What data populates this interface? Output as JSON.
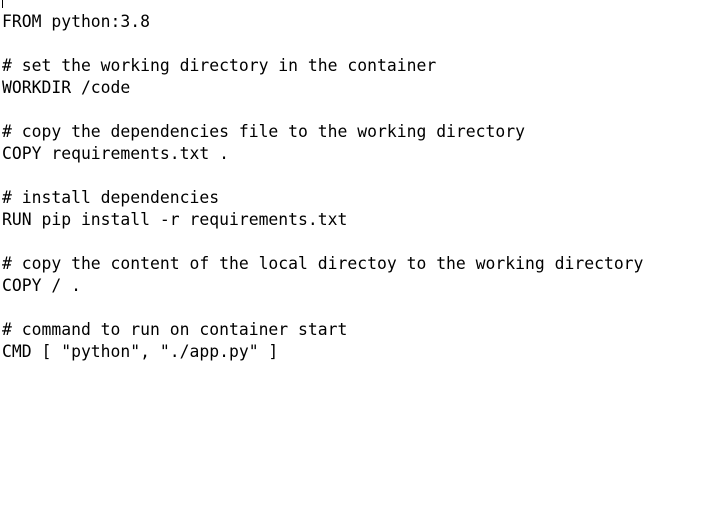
{
  "editor": {
    "lines": [
      "FROM python:3.8",
      "",
      "# set the working directory in the container",
      "WORKDIR /code",
      "",
      "# copy the dependencies file to the working directory",
      "COPY requirements.txt .",
      "",
      "# install dependencies",
      "RUN pip install -r requirements.txt",
      "",
      "# copy the content of the local directoy to the working directory",
      "COPY / .",
      "",
      "# command to run on container start",
      "CMD [ \"python\", \"./app.py\" ]"
    ]
  }
}
